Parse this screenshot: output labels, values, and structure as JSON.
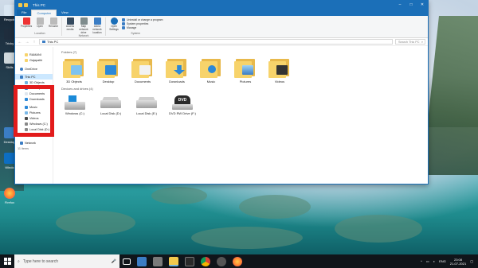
{
  "window": {
    "title": "This PC",
    "tabs": [
      "File",
      "Computer",
      "View"
    ]
  },
  "ribbon": {
    "groups": [
      {
        "name": "Location",
        "buttons": [
          "Properties",
          "Open",
          "Rename"
        ]
      },
      {
        "name": "Network",
        "buttons": [
          "Access media",
          "Map network drive",
          "Add a network location"
        ]
      },
      {
        "name": "System",
        "buttons": [
          "Open Settings"
        ],
        "small": [
          "Uninstall or change a program",
          "System properties",
          "Manage"
        ]
      }
    ]
  },
  "address": {
    "path": "This PC",
    "search_placeholder": "Search This PC"
  },
  "nav": {
    "items": [
      {
        "label": "RAMANI",
        "type": "quick"
      },
      {
        "label": "Gajapathi",
        "type": "quick"
      },
      {
        "label": "OneDrive",
        "type": "top"
      },
      {
        "label": "This PC",
        "type": "top",
        "selected": true
      },
      {
        "label": "3D Objects",
        "type": "sub"
      },
      {
        "label": "Desktop",
        "type": "sub"
      },
      {
        "label": "Documents",
        "type": "sub"
      },
      {
        "label": "Downloads",
        "type": "sub"
      },
      {
        "label": "Music",
        "type": "sub"
      },
      {
        "label": "Pictures",
        "type": "sub"
      },
      {
        "label": "Videos",
        "type": "sub"
      },
      {
        "label": "Windows (C:)",
        "type": "sub"
      },
      {
        "label": "Local Disk (D:)",
        "type": "sub"
      },
      {
        "label": "Local Disk (E:)",
        "type": "sub"
      },
      {
        "label": "Network",
        "type": "top"
      }
    ],
    "count_label": "11 items"
  },
  "sections": {
    "folders_header": "Folders (7)",
    "drives_header": "Devices and drives (4)"
  },
  "folders": [
    "3D Objects",
    "Desktop",
    "Documents",
    "Downloads",
    "Music",
    "Pictures",
    "Videos"
  ],
  "drives": [
    "Windows (C:)",
    "Local Disk (D:)",
    "Local Disk (E:)",
    "DVD RW Drive (F:)"
  ],
  "drive_icon_text": "DVD",
  "desktop_icons": [
    "Recycle",
    "Tricky",
    "Skills",
    "Desktop",
    "Windo",
    "Firefox"
  ],
  "taskbar": {
    "search_placeholder": "Type here to search",
    "tray": {
      "lang": "ENG",
      "time": "23:08",
      "date": "21-07-2021"
    }
  }
}
